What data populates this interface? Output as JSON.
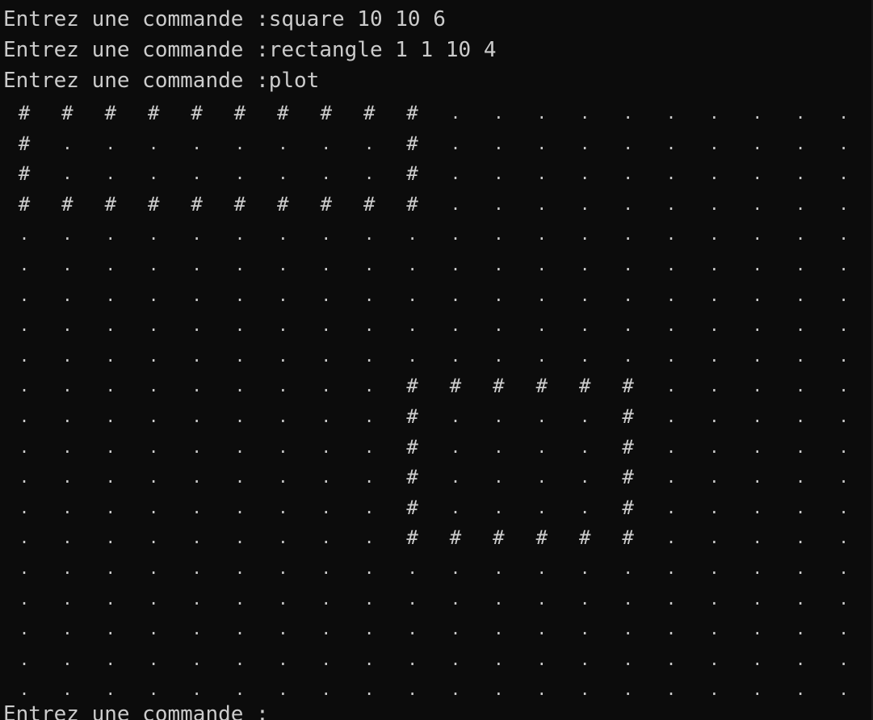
{
  "terminal": {
    "background": "#0c0c0c",
    "foreground": "#cccccc",
    "partial_top_line": "Entrez une commande :square 10 10 6",
    "command_lines": [
      "Entrez une commande :square 10 10 6",
      "Entrez une commande :rectangle 1 1 10 4",
      "Entrez une commande :plot"
    ],
    "final_prompt": "Entrez une commande :"
  },
  "plot": {
    "columns": 20,
    "rows": 20,
    "fill_char": "#",
    "empty_char": ".",
    "rows_text": [
      "##########..........",
      "#........#..........",
      "#........#..........",
      "##########..........",
      "....................",
      "....................",
      "....................",
      "....................",
      "....................",
      ".........######.....",
      ".........#....#.....",
      ".........#....#.....",
      ".........#....#.....",
      ".........#....#.....",
      ".........######.....",
      "....................",
      "....................",
      "....................",
      "....................",
      "...................."
    ]
  }
}
